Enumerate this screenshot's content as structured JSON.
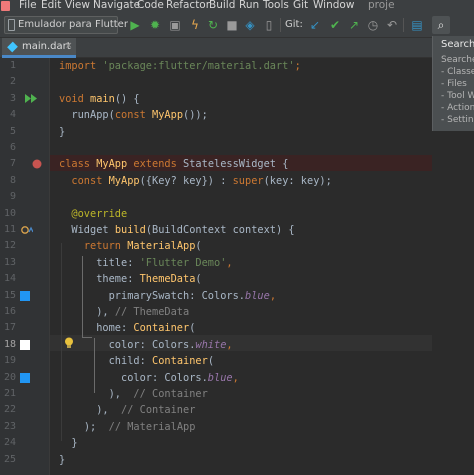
{
  "menu": [
    "File",
    "Edit",
    "View",
    "Navigate",
    "Code",
    "Refactor",
    "Build",
    "Run",
    "Tools",
    "Git",
    "Window"
  ],
  "project_label": "proje",
  "toolbar": {
    "device_label": "Emulador para Flutter",
    "git_label": "Git:"
  },
  "tab": {
    "label": "main.dart",
    "close": "×"
  },
  "search_popup": {
    "title": "Search E",
    "subtitle": "Searches",
    "items": [
      "- Classes",
      "- Files",
      "- Tool Wi",
      "- Actions",
      "- Setting"
    ]
  },
  "line_numbers": [
    "1",
    "2",
    "3",
    "4",
    "5",
    "6",
    "7",
    "8",
    "9",
    "10",
    "11",
    "12",
    "13",
    "14",
    "15",
    "16",
    "17",
    "18",
    "19",
    "20",
    "21",
    "22",
    "23",
    "24",
    "25"
  ],
  "gutter_colors": {
    "blue": "#2196f3",
    "white": "#ffffff"
  },
  "colors": {
    "keyword": "#cc7832",
    "string": "#6a8759",
    "function": "#ffc66d",
    "comment": "#808080",
    "annotation": "#bbb529",
    "constant": "#9876aa"
  },
  "code": {
    "l1": {
      "kw": "import",
      "str": "'package:flutter/material.dart'",
      "end": ";"
    },
    "l3": {
      "kw": "void",
      "fn": "main",
      "rest": "() {"
    },
    "l4": {
      "a": "runApp(",
      "kw": "const",
      "cls": "MyApp",
      "b": "());"
    },
    "l5": {
      "a": "}"
    },
    "l7": {
      "kw1": "class",
      "cls": "MyApp",
      "kw2": "extends",
      "rest": "StatelessWidget {"
    },
    "l8": {
      "kw": "const",
      "cls": "MyApp",
      "a": "({Key? key}) : ",
      "kw2": "super",
      "b": "(key: key);"
    },
    "l10": {
      "an": "@override"
    },
    "l11": {
      "a": "Widget",
      "fn": "build",
      "b": "(BuildContext context) {"
    },
    "l12": {
      "kw": "return",
      "cls": "MaterialApp",
      "b": "("
    },
    "l13": {
      "a": "title: ",
      "str": "'Flutter Demo'",
      "b": ","
    },
    "l14": {
      "a": "theme: ",
      "cls": "ThemeData",
      "b": "("
    },
    "l15": {
      "a": "primarySwatch: Colors.",
      "it": "blue",
      "b": ","
    },
    "l16": {
      "a": "), ",
      "cmt": "// ThemeData"
    },
    "l17": {
      "a": "home: ",
      "cls": "Container",
      "b": "("
    },
    "l18": {
      "a": "color: Colors.",
      "it": "white",
      "b": ","
    },
    "l19": {
      "a": "child: ",
      "cls": "Container",
      "b": "("
    },
    "l20": {
      "a": "color: Colors.",
      "it": "blue",
      "b": ","
    },
    "l21": {
      "a": "),  ",
      "cmt": "// Container"
    },
    "l22": {
      "a": "),  ",
      "cmt": "// Container"
    },
    "l23": {
      "a": ");  ",
      "cmt": "// MaterialApp"
    },
    "l24": {
      "a": "}"
    },
    "l25": {
      "a": "}"
    }
  }
}
